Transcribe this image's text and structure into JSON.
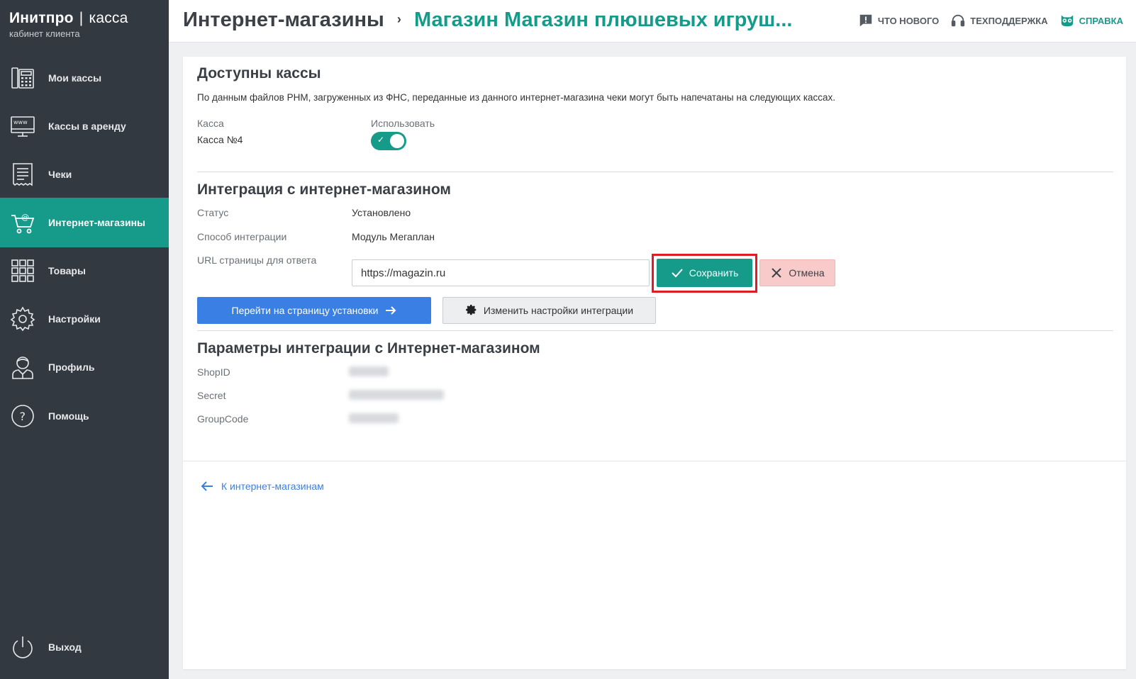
{
  "brand": {
    "name_bold": "Инитпро",
    "separator": "|",
    "name_light": "касса",
    "subtitle": "кабинет клиента"
  },
  "sidebar": {
    "items": [
      {
        "label": "Мои кассы",
        "icon": "cash-register-icon"
      },
      {
        "label": "Кассы в аренду",
        "icon": "www-terminal-icon"
      },
      {
        "label": "Чеки",
        "icon": "receipt-icon"
      },
      {
        "label": "Интернет-магазины",
        "icon": "online-cart-icon",
        "active": true
      },
      {
        "label": "Товары",
        "icon": "grid-icon"
      },
      {
        "label": "Настройки",
        "icon": "gear-icon"
      },
      {
        "label": "Профиль",
        "icon": "user-icon"
      },
      {
        "label": "Помощь",
        "icon": "help-circle-icon"
      }
    ],
    "logout_label": "Выход"
  },
  "header": {
    "breadcrumb_parent": "Интернет-магазины",
    "breadcrumb_separator": "›",
    "breadcrumb_current": "Магазин Магазин плюшевых игруш...",
    "whats_new": "ЧТО НОВОГО",
    "support": "ТЕХПОДДЕРЖКА",
    "help": "СПРАВКА"
  },
  "available_registers": {
    "title": "Доступны кассы",
    "description": "По данным файлов РНМ, загруженных из ФНС, переданные из данного интернет-магазина чеки могут быть напечатаны на следующих кассах.",
    "col_register": "Касса",
    "col_use": "Использовать",
    "register_name": "Касса №4",
    "use_enabled": true
  },
  "integration": {
    "title": "Интеграция с интернет-магазином",
    "status_label": "Статус",
    "status_value": "Установлено",
    "method_label": "Способ интеграции",
    "method_value": "Модуль Мегаплан",
    "url_label": "URL страницы для ответа",
    "url_value": "https://magazin.ru",
    "save_button": "Сохранить",
    "cancel_button": "Отмена",
    "goto_install_button": "Перейти на страницу установки",
    "change_settings_button": "Изменить настройки интеграции"
  },
  "params": {
    "title": "Параметры интеграции с Интернет-магазином",
    "shopid_label": "ShopID",
    "shopid_value": "",
    "secret_label": "Secret",
    "secret_value": "",
    "groupcode_label": "GroupCode",
    "groupcode_value": ""
  },
  "back_link": "К интернет-магазинам",
  "colors": {
    "sidebar": "#333941",
    "accent": "#169a8a",
    "primary": "#3a7fe3",
    "danger_bg": "#f9caca",
    "highlight": "#e01b24"
  }
}
